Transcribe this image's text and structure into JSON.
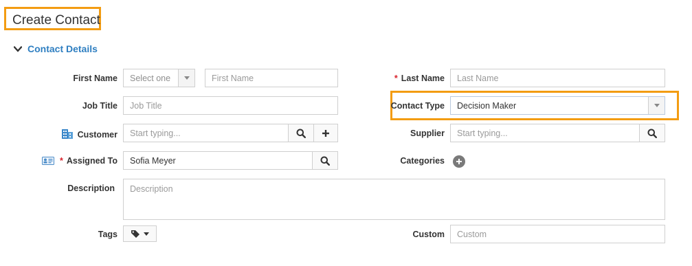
{
  "page": {
    "title": "Create Contact"
  },
  "section": {
    "title": "Contact Details"
  },
  "labels": {
    "first_name": "First Name",
    "last_name": "Last Name",
    "job_title": "Job Title",
    "contact_type": "Contact Type",
    "customer": "Customer",
    "supplier": "Supplier",
    "assigned_to": "Assigned To",
    "categories": "Categories",
    "description": "Description",
    "tags": "Tags",
    "custom": "Custom",
    "required_marker": "*"
  },
  "fields": {
    "salutation_select": {
      "value": "Select one"
    },
    "first_name": {
      "value": "",
      "placeholder": "First Name"
    },
    "last_name": {
      "value": "",
      "placeholder": "Last Name"
    },
    "job_title": {
      "value": "",
      "placeholder": "Job Title"
    },
    "contact_type": {
      "value": "Decision Maker"
    },
    "customer": {
      "value": "",
      "placeholder": "Start typing..."
    },
    "supplier": {
      "value": "",
      "placeholder": "Start typing..."
    },
    "assigned_to": {
      "value": "Sofia Meyer"
    },
    "description": {
      "value": "",
      "placeholder": "Description"
    },
    "custom": {
      "value": "",
      "placeholder": "Custom"
    }
  },
  "colors": {
    "highlight": "#f39c12",
    "section_title": "#2f7fc1",
    "required": "#d9232d",
    "customer_icon": "#3a87c9"
  }
}
